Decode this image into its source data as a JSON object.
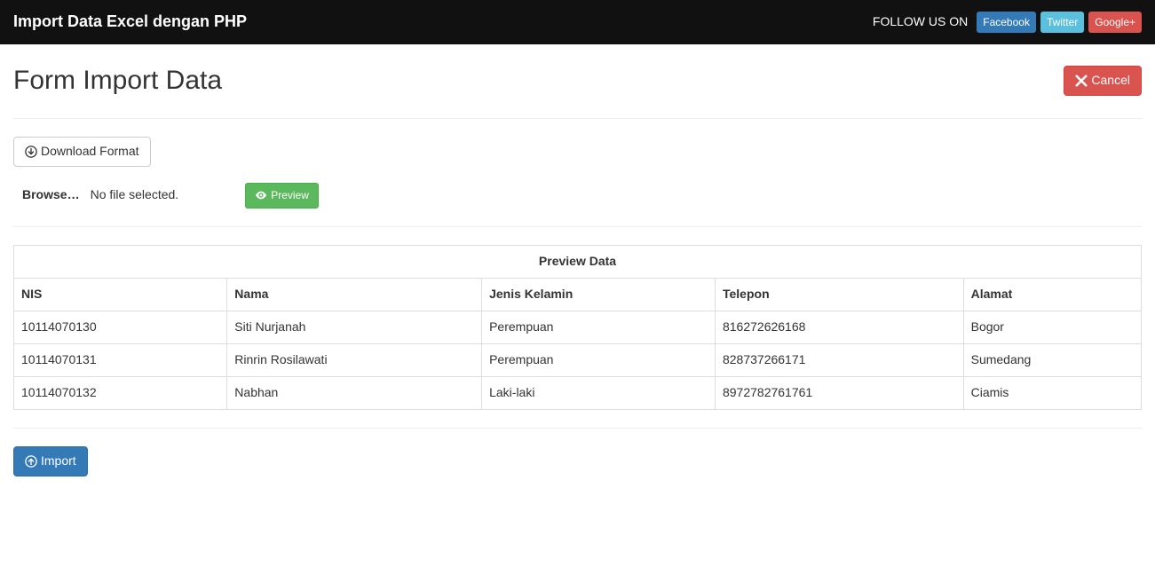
{
  "navbar": {
    "brand": "Import Data Excel dengan PHP",
    "follow_text": "FOLLOW US ON",
    "facebook_label": "Facebook",
    "twitter_label": "Twitter",
    "google_label": "Google+"
  },
  "header": {
    "title": "Form Import Data",
    "cancel_label": "Cancel"
  },
  "actions": {
    "download_format_label": "Download Format",
    "preview_label": "Preview",
    "import_label": "Import"
  },
  "file_input": {
    "browse_label": "Browse…",
    "status": "No file selected."
  },
  "table": {
    "caption": "Preview Data",
    "headers": {
      "nis": "NIS",
      "nama": "Nama",
      "jenis_kelamin": "Jenis Kelamin",
      "telepon": "Telepon",
      "alamat": "Alamat"
    },
    "rows": [
      {
        "nis": "10114070130",
        "nama": "Siti Nurjanah",
        "jenis_kelamin": "Perempuan",
        "telepon": "816272626168",
        "alamat": "Bogor"
      },
      {
        "nis": "10114070131",
        "nama": "Rinrin Rosilawati",
        "jenis_kelamin": "Perempuan",
        "telepon": "828737266171",
        "alamat": "Sumedang"
      },
      {
        "nis": "10114070132",
        "nama": "Nabhan",
        "jenis_kelamin": "Laki-laki",
        "telepon": "8972782761761",
        "alamat": "Ciamis"
      }
    ]
  }
}
